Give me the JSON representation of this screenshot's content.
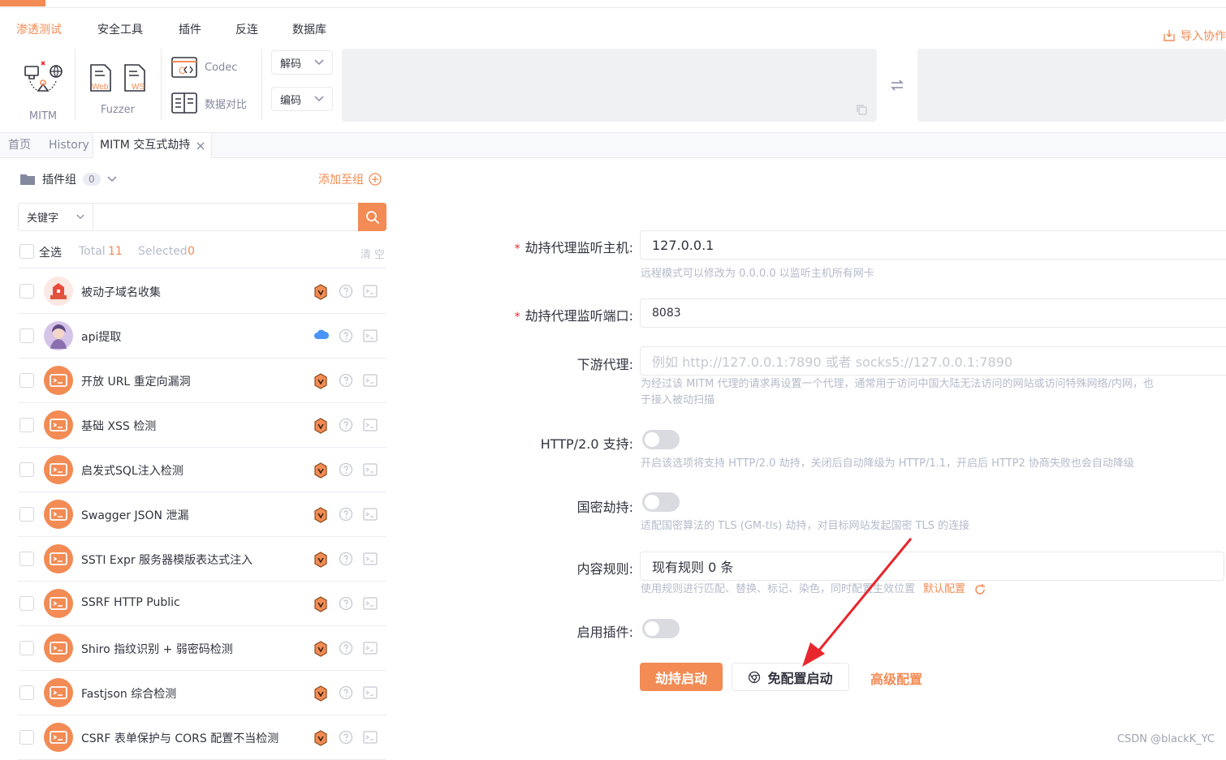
{
  "menu": {
    "items": [
      "渗透测试",
      "安全工具",
      "插件",
      "反连",
      "数据库"
    ],
    "active_index": 0,
    "import_label": "导入协作"
  },
  "toolbar": {
    "mitm_label": "MITM",
    "fuzzer_label": "Fuzzer",
    "codec_label": "Codec",
    "compare_label": "数据对比",
    "decode_label": "解码",
    "encode_label": "编码"
  },
  "tabs": {
    "home": "首页",
    "history": "History",
    "mitm": "MITM 交互式劫持"
  },
  "plugins": {
    "group_label": "插件组",
    "group_count": "0",
    "add_to_group": "添加至组",
    "filter_type": "关键字",
    "select_all": "全选",
    "total_label": "Total",
    "total_value": "11",
    "selected_label": "Selected",
    "selected_value": "0",
    "clear_label": "清 空",
    "items": [
      {
        "name": "被动子域名收集",
        "badge": "shield",
        "avatar": "house"
      },
      {
        "name": "api提取",
        "badge": "cloud",
        "avatar": "photo"
      },
      {
        "name": "开放 URL 重定向漏洞",
        "badge": "shield",
        "avatar": "script"
      },
      {
        "name": "基础 XSS 检测",
        "badge": "shield",
        "avatar": "script"
      },
      {
        "name": "启发式SQL注入检测",
        "badge": "shield",
        "avatar": "script"
      },
      {
        "name": "Swagger JSON 泄漏",
        "badge": "shield",
        "avatar": "script"
      },
      {
        "name": "SSTI Expr 服务器模版表达式注入",
        "badge": "shield",
        "avatar": "script"
      },
      {
        "name": "SSRF HTTP Public",
        "badge": "shield",
        "avatar": "script"
      },
      {
        "name": "Shiro 指纹识别 + 弱密码检测",
        "badge": "shield",
        "avatar": "script"
      },
      {
        "name": "Fastjson 综合检测",
        "badge": "shield",
        "avatar": "script"
      },
      {
        "name": "CSRF 表单保护与 CORS 配置不当检测",
        "badge": "shield",
        "avatar": "script"
      }
    ]
  },
  "form": {
    "host_label": "劫持代理监听主机:",
    "host_value": "127.0.0.1",
    "host_help": "远程模式可以修改为 0.0.0.0 以监听主机所有网卡",
    "port_label": "劫持代理监听端口:",
    "port_value": "8083",
    "downstream_label": "下游代理:",
    "downstream_placeholder": "例如 http://127.0.0.1:7890 或者 socks5://127.0.0.1:7890",
    "downstream_help_1": "为经过该 MITM 代理的请求再设置一个代理，通常用于访问中国大陆无法访问的网站或访问特殊网络/内网，也",
    "downstream_help_2": "于接入被动扫描",
    "http2_label": "HTTP/2.0 支持:",
    "http2_help": "开启该选项将支持 HTTP/2.0 劫持，关闭后自动降级为 HTTP/1.1，开启后 HTTP2 协商失败也会自动降级",
    "http2_enabled": false,
    "gm_label": "国密劫持:",
    "gm_help": "适配国密算法的 TLS (GM-tls) 劫持，对目标网站发起国密 TLS 的连接",
    "gm_enabled": false,
    "rules_label": "内容规则:",
    "rules_value": "现有规则 0 条",
    "rules_help": "使用规则进行匹配、替换、标记、染色，同时配置生效位置",
    "rules_default_link": "默认配置",
    "plugin_label": "启用插件:",
    "plugin_enabled": false,
    "start_button": "劫持启动",
    "quick_start_button": "免配置启动",
    "advanced_link": "高级配置"
  },
  "watermark": "CSDN @blackK_YC",
  "colors": {
    "accent": "#f28b54",
    "arrow": "#e8262d"
  }
}
